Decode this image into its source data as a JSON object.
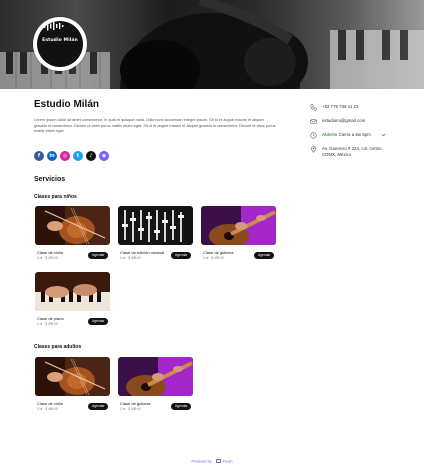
{
  "banner": {
    "logo_text": "Estudio Milán"
  },
  "business": {
    "name": "Estudio Milán",
    "description": "Lorem ipsum dolor sit amet consectetur. In quis et quisque nulla. Odio nunc accumsan integer ipsum. Sit id et augue mauris et aliquet gravida in consectetur. Dictum ut vitae purus mattis etiam eget. Sit id et augue mauris et aliquet gravida in consectetur. Dictum ut vitae purus mattis etiam eget."
  },
  "socials": [
    {
      "icon": "facebook-icon",
      "glyph": "f",
      "color": "#3b5998"
    },
    {
      "icon": "linkedin-icon",
      "glyph": "in",
      "color": "#0a66c2"
    },
    {
      "icon": "instagram-icon",
      "glyph": "◎",
      "color": "#d6249f"
    },
    {
      "icon": "twitter-icon",
      "glyph": "t",
      "color": "#1da1f2"
    },
    {
      "icon": "tiktok-icon",
      "glyph": "♪",
      "color": "#111111"
    },
    {
      "icon": "website-icon",
      "glyph": "◉",
      "color": "#7b61ff"
    }
  ],
  "contact": {
    "phone": "+52 775 738 11 23",
    "email": "estudiomi@gmail.com",
    "status_open": "Abierto",
    "status_hours": "Cierra a las 5pm",
    "address": "Av. Guerrero # 224, col. centro, CDMX, México"
  },
  "services": {
    "title": "Servicios",
    "groups": [
      {
        "title": "Clases para niños",
        "items": [
          {
            "name": "Clase de violín",
            "meta": "1 hr · $ 499.00",
            "button": "Agendar",
            "image": "violin"
          },
          {
            "name": "Clase de edición musical",
            "meta": "1 hr · $ 499.00",
            "button": "Agendar",
            "image": "mixer"
          },
          {
            "name": "Clase de guitarra",
            "meta": "1 hr · $ 499.00",
            "button": "Agendar",
            "image": "guitar"
          },
          {
            "name": "Clase de piano",
            "meta": "1 hr · $ 499.00",
            "button": "Agendar",
            "image": "piano"
          }
        ]
      },
      {
        "title": "Clases para adultos",
        "items": [
          {
            "name": "Clase de violín",
            "meta": "1 hr · $ 499.00",
            "button": "Agendar",
            "image": "violin"
          },
          {
            "name": "Clase de guitarra",
            "meta": "1 hr · $ 499.00",
            "button": "Agendar",
            "image": "guitar"
          }
        ]
      }
    ]
  },
  "footer": {
    "prefix": "Powered by",
    "brand": "Fresh"
  }
}
